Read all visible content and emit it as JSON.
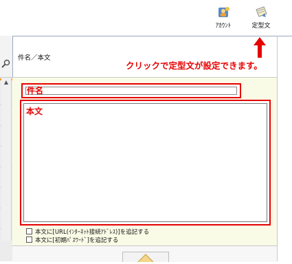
{
  "toolbar": {
    "account_label": "ｱｶｳﾝﾄ",
    "template_label": "定型文"
  },
  "compose": {
    "subject_body_label": "件名／本文",
    "hint": "クリックで定型文が設定できます。",
    "subject_field_label": "件名",
    "body_field_label": "本文",
    "option_url": "本文に[URL(ｲﾝﾀｰﾈｯﾄ接続ｱﾄﾞﾚｽ)]を追記する",
    "option_password": "本文に[初期ﾊﾟｽﾜｰﾄﾞ]を追記する"
  },
  "colors": {
    "annotation_red": "#e60000",
    "form_background": "#fafbe6"
  }
}
